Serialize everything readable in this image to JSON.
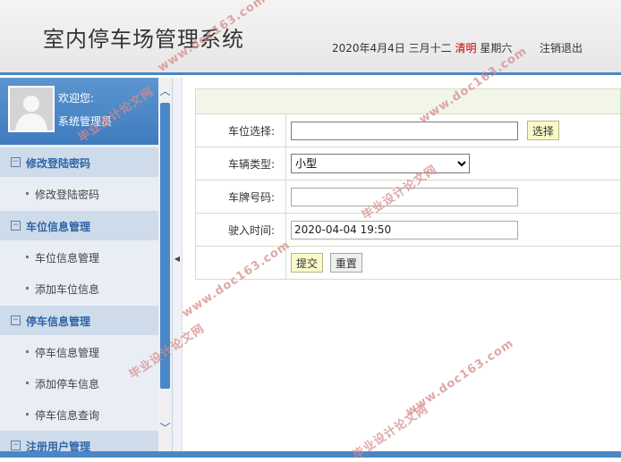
{
  "header": {
    "title": "室内停车场管理系统",
    "date": "2020年4月4日",
    "lunar_date": "三月十二",
    "solar_term": "清明",
    "weekday": "星期六",
    "logout_label": "注销退出"
  },
  "sidebar": {
    "welcome": "欢迎您:",
    "user_name": "系统管理员",
    "groups": [
      {
        "label": "修改登陆密码",
        "items": [
          {
            "label": "修改登陆密码"
          }
        ]
      },
      {
        "label": "车位信息管理",
        "items": [
          {
            "label": "车位信息管理"
          },
          {
            "label": "添加车位信息"
          }
        ]
      },
      {
        "label": "停车信息管理",
        "items": [
          {
            "label": "停车信息管理"
          },
          {
            "label": "添加停车信息"
          },
          {
            "label": "停车信息查询"
          }
        ]
      },
      {
        "label": "注册用户管理",
        "items": []
      }
    ]
  },
  "form": {
    "parking_spot_label": "车位选择:",
    "parking_spot_value": "",
    "select_button": "选择",
    "vehicle_type_label": "车辆类型:",
    "vehicle_type_value": "小型",
    "plate_label": "车牌号码:",
    "plate_value": "",
    "entry_time_label": "驶入时间:",
    "entry_time_value": "2020-04-04 19:50",
    "submit_button": "提交",
    "reset_button": "重置"
  },
  "watermarks": [
    "www.doc163.com",
    "毕业设计论文网"
  ],
  "colors": {
    "accent": "#4a87c6",
    "menu_text": "#2e64a8",
    "festival": "#c80000"
  }
}
